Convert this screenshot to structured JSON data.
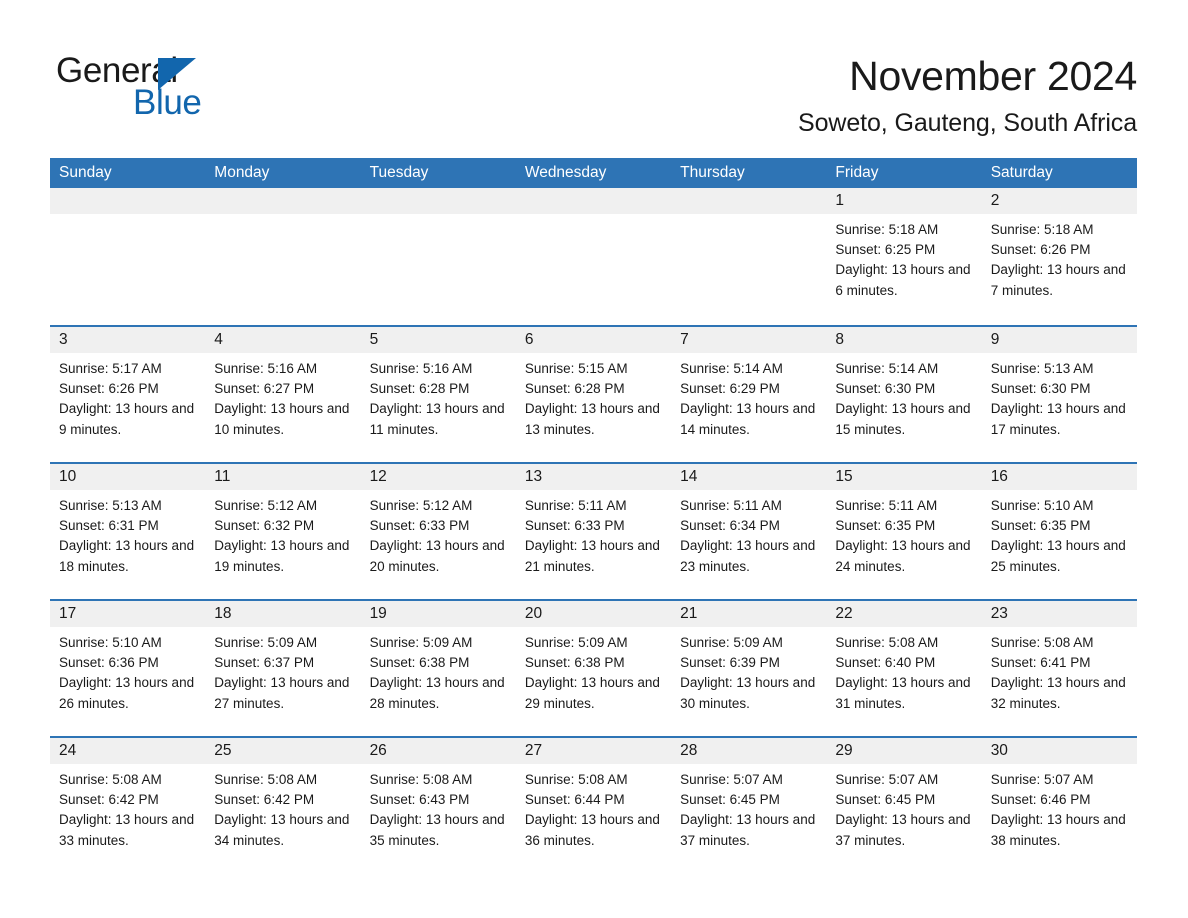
{
  "brand": {
    "name_part1": "General",
    "name_part2": "Blue",
    "triangle_color": "#1266ad",
    "accent_color": "#2e74b5"
  },
  "header": {
    "title": "November 2024",
    "subtitle": "Soweto, Gauteng, South Africa"
  },
  "calendar": {
    "weekday_headers": [
      "Sunday",
      "Monday",
      "Tuesday",
      "Wednesday",
      "Thursday",
      "Friday",
      "Saturday"
    ],
    "header_bg": "#2e74b5",
    "daynum_bg": "#f0f0f0",
    "weeks": [
      [
        {
          "day": "",
          "sunrise": "",
          "sunset": "",
          "daylight": "",
          "empty": true
        },
        {
          "day": "",
          "sunrise": "",
          "sunset": "",
          "daylight": "",
          "empty": true
        },
        {
          "day": "",
          "sunrise": "",
          "sunset": "",
          "daylight": "",
          "empty": true
        },
        {
          "day": "",
          "sunrise": "",
          "sunset": "",
          "daylight": "",
          "empty": true
        },
        {
          "day": "",
          "sunrise": "",
          "sunset": "",
          "daylight": "",
          "empty": true
        },
        {
          "day": "1",
          "sunrise": "Sunrise: 5:18 AM",
          "sunset": "Sunset: 6:25 PM",
          "daylight": "Daylight: 13 hours and 6 minutes.",
          "empty": false
        },
        {
          "day": "2",
          "sunrise": "Sunrise: 5:18 AM",
          "sunset": "Sunset: 6:26 PM",
          "daylight": "Daylight: 13 hours and 7 minutes.",
          "empty": false
        }
      ],
      [
        {
          "day": "3",
          "sunrise": "Sunrise: 5:17 AM",
          "sunset": "Sunset: 6:26 PM",
          "daylight": "Daylight: 13 hours and 9 minutes.",
          "empty": false
        },
        {
          "day": "4",
          "sunrise": "Sunrise: 5:16 AM",
          "sunset": "Sunset: 6:27 PM",
          "daylight": "Daylight: 13 hours and 10 minutes.",
          "empty": false
        },
        {
          "day": "5",
          "sunrise": "Sunrise: 5:16 AM",
          "sunset": "Sunset: 6:28 PM",
          "daylight": "Daylight: 13 hours and 11 minutes.",
          "empty": false
        },
        {
          "day": "6",
          "sunrise": "Sunrise: 5:15 AM",
          "sunset": "Sunset: 6:28 PM",
          "daylight": "Daylight: 13 hours and 13 minutes.",
          "empty": false
        },
        {
          "day": "7",
          "sunrise": "Sunrise: 5:14 AM",
          "sunset": "Sunset: 6:29 PM",
          "daylight": "Daylight: 13 hours and 14 minutes.",
          "empty": false
        },
        {
          "day": "8",
          "sunrise": "Sunrise: 5:14 AM",
          "sunset": "Sunset: 6:30 PM",
          "daylight": "Daylight: 13 hours and 15 minutes.",
          "empty": false
        },
        {
          "day": "9",
          "sunrise": "Sunrise: 5:13 AM",
          "sunset": "Sunset: 6:30 PM",
          "daylight": "Daylight: 13 hours and 17 minutes.",
          "empty": false
        }
      ],
      [
        {
          "day": "10",
          "sunrise": "Sunrise: 5:13 AM",
          "sunset": "Sunset: 6:31 PM",
          "daylight": "Daylight: 13 hours and 18 minutes.",
          "empty": false
        },
        {
          "day": "11",
          "sunrise": "Sunrise: 5:12 AM",
          "sunset": "Sunset: 6:32 PM",
          "daylight": "Daylight: 13 hours and 19 minutes.",
          "empty": false
        },
        {
          "day": "12",
          "sunrise": "Sunrise: 5:12 AM",
          "sunset": "Sunset: 6:33 PM",
          "daylight": "Daylight: 13 hours and 20 minutes.",
          "empty": false
        },
        {
          "day": "13",
          "sunrise": "Sunrise: 5:11 AM",
          "sunset": "Sunset: 6:33 PM",
          "daylight": "Daylight: 13 hours and 21 minutes.",
          "empty": false
        },
        {
          "day": "14",
          "sunrise": "Sunrise: 5:11 AM",
          "sunset": "Sunset: 6:34 PM",
          "daylight": "Daylight: 13 hours and 23 minutes.",
          "empty": false
        },
        {
          "day": "15",
          "sunrise": "Sunrise: 5:11 AM",
          "sunset": "Sunset: 6:35 PM",
          "daylight": "Daylight: 13 hours and 24 minutes.",
          "empty": false
        },
        {
          "day": "16",
          "sunrise": "Sunrise: 5:10 AM",
          "sunset": "Sunset: 6:35 PM",
          "daylight": "Daylight: 13 hours and 25 minutes.",
          "empty": false
        }
      ],
      [
        {
          "day": "17",
          "sunrise": "Sunrise: 5:10 AM",
          "sunset": "Sunset: 6:36 PM",
          "daylight": "Daylight: 13 hours and 26 minutes.",
          "empty": false
        },
        {
          "day": "18",
          "sunrise": "Sunrise: 5:09 AM",
          "sunset": "Sunset: 6:37 PM",
          "daylight": "Daylight: 13 hours and 27 minutes.",
          "empty": false
        },
        {
          "day": "19",
          "sunrise": "Sunrise: 5:09 AM",
          "sunset": "Sunset: 6:38 PM",
          "daylight": "Daylight: 13 hours and 28 minutes.",
          "empty": false
        },
        {
          "day": "20",
          "sunrise": "Sunrise: 5:09 AM",
          "sunset": "Sunset: 6:38 PM",
          "daylight": "Daylight: 13 hours and 29 minutes.",
          "empty": false
        },
        {
          "day": "21",
          "sunrise": "Sunrise: 5:09 AM",
          "sunset": "Sunset: 6:39 PM",
          "daylight": "Daylight: 13 hours and 30 minutes.",
          "empty": false
        },
        {
          "day": "22",
          "sunrise": "Sunrise: 5:08 AM",
          "sunset": "Sunset: 6:40 PM",
          "daylight": "Daylight: 13 hours and 31 minutes.",
          "empty": false
        },
        {
          "day": "23",
          "sunrise": "Sunrise: 5:08 AM",
          "sunset": "Sunset: 6:41 PM",
          "daylight": "Daylight: 13 hours and 32 minutes.",
          "empty": false
        }
      ],
      [
        {
          "day": "24",
          "sunrise": "Sunrise: 5:08 AM",
          "sunset": "Sunset: 6:42 PM",
          "daylight": "Daylight: 13 hours and 33 minutes.",
          "empty": false
        },
        {
          "day": "25",
          "sunrise": "Sunrise: 5:08 AM",
          "sunset": "Sunset: 6:42 PM",
          "daylight": "Daylight: 13 hours and 34 minutes.",
          "empty": false
        },
        {
          "day": "26",
          "sunrise": "Sunrise: 5:08 AM",
          "sunset": "Sunset: 6:43 PM",
          "daylight": "Daylight: 13 hours and 35 minutes.",
          "empty": false
        },
        {
          "day": "27",
          "sunrise": "Sunrise: 5:08 AM",
          "sunset": "Sunset: 6:44 PM",
          "daylight": "Daylight: 13 hours and 36 minutes.",
          "empty": false
        },
        {
          "day": "28",
          "sunrise": "Sunrise: 5:07 AM",
          "sunset": "Sunset: 6:45 PM",
          "daylight": "Daylight: 13 hours and 37 minutes.",
          "empty": false
        },
        {
          "day": "29",
          "sunrise": "Sunrise: 5:07 AM",
          "sunset": "Sunset: 6:45 PM",
          "daylight": "Daylight: 13 hours and 37 minutes.",
          "empty": false
        },
        {
          "day": "30",
          "sunrise": "Sunrise: 5:07 AM",
          "sunset": "Sunset: 6:46 PM",
          "daylight": "Daylight: 13 hours and 38 minutes.",
          "empty": false
        }
      ]
    ]
  }
}
